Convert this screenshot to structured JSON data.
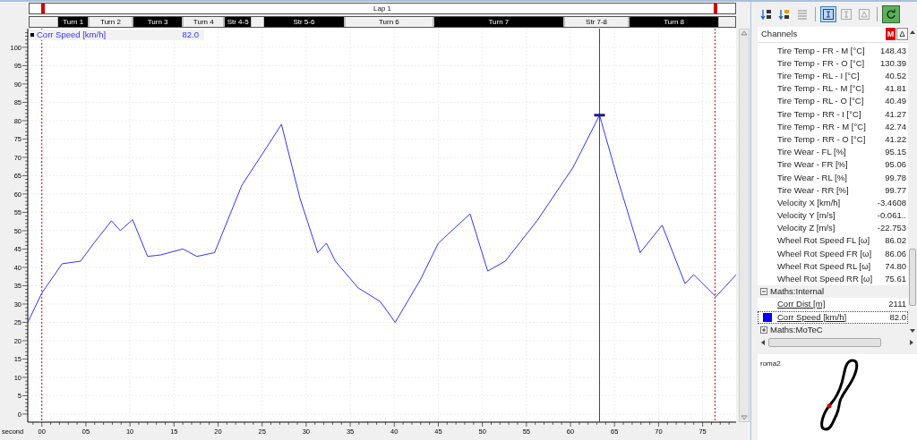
{
  "lap_bar": {
    "label": "Lap 1"
  },
  "sections": [
    {
      "label": "Turn 1",
      "color": "#000000"
    },
    {
      "label": "Turn 2",
      "color": "#f0f0f0"
    },
    {
      "label": "Turn 3",
      "color": "#000000"
    },
    {
      "label": "Turn 4",
      "color": "#f0f0f0"
    },
    {
      "label": "Str 4-5",
      "color": "#000000"
    },
    {
      "label": "Str 5-6",
      "color": "#000000"
    },
    {
      "label": "Turn 6",
      "color": "#f0f0f0"
    },
    {
      "label": "Turn 7",
      "color": "#000000"
    },
    {
      "label": "Str 7-8",
      "color": "#f0f0f0"
    },
    {
      "label": "Turn 8",
      "color": "#000000"
    }
  ],
  "legend": {
    "value": "82.0"
  },
  "chart": {
    "chart_data": {
      "type": "line",
      "xlabel": "second",
      "grid": true,
      "x": [
        -1.6,
        0,
        2.3,
        4.4,
        5.9,
        7.9,
        8.9,
        10.3,
        12,
        13.5,
        16,
        17.6,
        19.6,
        22.7,
        25.7,
        27.2,
        29.3,
        31.3,
        32.3,
        33.3,
        35.9,
        38.4,
        40.1,
        43,
        45,
        48.6,
        50.6,
        52.6,
        56.2,
        60.3,
        63.3,
        65.4,
        67.9,
        70.4,
        73,
        74,
        76.5,
        78.8
      ],
      "series": [
        {
          "name": "Corr Speed [km/h]",
          "color": "#3333ff",
          "values": [
            25,
            33,
            41,
            41.7,
            46.6,
            52.7,
            50,
            53,
            43,
            43.4,
            45,
            43,
            44,
            62.4,
            73.4,
            79,
            58.8,
            44,
            46.6,
            41.7,
            34.4,
            30.7,
            25,
            36.8,
            46.6,
            54.6,
            39,
            41.7,
            52.7,
            67.3,
            81.5,
            63.7,
            44,
            51.5,
            35.6,
            38,
            32,
            38
          ]
        }
      ],
      "xlim": [
        -1.6,
        78.8
      ],
      "ylim": [
        -2.2,
        105.1
      ],
      "xticks": [
        {
          "value": 0,
          "label": "00"
        },
        {
          "value": 5,
          "label": "05"
        },
        {
          "value": 10,
          "label": "10"
        },
        {
          "value": 15,
          "label": "15"
        },
        {
          "value": 20,
          "label": "20"
        },
        {
          "value": 25,
          "label": "25"
        },
        {
          "value": 30,
          "label": "30"
        },
        {
          "value": 35,
          "label": "35"
        },
        {
          "value": 40,
          "label": "40"
        },
        {
          "value": 45,
          "label": "45"
        },
        {
          "value": 50,
          "label": "50"
        },
        {
          "value": 55,
          "label": "55"
        },
        {
          "value": 60,
          "label": "60"
        },
        {
          "value": 65,
          "label": "65"
        },
        {
          "value": 70,
          "label": "70"
        },
        {
          "value": 75,
          "label": "75"
        }
      ],
      "yticks": [
        0,
        5,
        10,
        15,
        20,
        25,
        30,
        35,
        40,
        45,
        50,
        55,
        60,
        65,
        70,
        75,
        80,
        85,
        90,
        95,
        100
      ],
      "ref_lines": [
        {
          "axis": "x",
          "value": 0,
          "color": "#cc0000"
        },
        {
          "axis": "x",
          "value": 76.4,
          "color": "#cc0000"
        },
        {
          "axis": "x",
          "value": 63.3,
          "color": "#3333ff"
        }
      ]
    }
  },
  "toolbar": [
    {
      "kind": "sort-numeric"
    },
    {
      "kind": "sort-alpha"
    },
    {
      "kind": "list"
    },
    {
      "kind": "separator"
    },
    {
      "kind": "cursor",
      "pressed": true
    },
    {
      "kind": "cursor",
      "pressed": false
    },
    {
      "kind": "delta",
      "pressed": false
    },
    {
      "kind": "separator"
    },
    {
      "kind": "refresh"
    }
  ],
  "channels": {
    "header": "Channels",
    "mode_button": "M",
    "delta_button": "Δ",
    "items": [
      {
        "name": "Tire Temp - FR - M [°C]",
        "value": "148.43",
        "selected": false
      },
      {
        "name": "Tire Temp - FR - O [°C]",
        "value": "130.39",
        "selected": false
      },
      {
        "name": "Tire Temp - RL - I [°C]",
        "value": "40.52",
        "selected": false
      },
      {
        "name": "Tire Temp - RL - M [°C]",
        "value": "41.81",
        "selected": false
      },
      {
        "name": "Tire Temp - RL - O [°C]",
        "value": "40.49",
        "selected": false
      },
      {
        "name": "Tire Temp - RR - I [°C]",
        "value": "41.27",
        "selected": false
      },
      {
        "name": "Tire Temp - RR - M [°C]",
        "value": "42.74",
        "selected": false
      },
      {
        "name": "Tire Temp - RR - O [°C]",
        "value": "41.22",
        "selected": false
      },
      {
        "name": "Tire Wear - FL [%]",
        "value": "95.15",
        "selected": false
      },
      {
        "name": "Tire Wear - FR [%]",
        "value": "95.06",
        "selected": false
      },
      {
        "name": "Tire Wear - RL [%]",
        "value": "99.78",
        "selected": false
      },
      {
        "name": "Tire Wear - RR [%]",
        "value": "99.77",
        "selected": false
      },
      {
        "name": "Velocity X [km/h]",
        "value": "-3.4608",
        "selected": false
      },
      {
        "name": "Velocity Y [m/s]",
        "value": "-0.061..",
        "selected": false
      },
      {
        "name": "Velocity Z [m/s]",
        "value": "-22.753",
        "selected": false
      },
      {
        "name": "Wheel Rot Speed FL [ω]",
        "value": "86.02",
        "selected": false
      },
      {
        "name": "Wheel Rot Speed FR [ω]",
        "value": "86.06",
        "selected": false
      },
      {
        "name": "Wheel Rot Speed RL [ω]",
        "value": "74.80",
        "selected": false
      },
      {
        "name": "Wheel Rot Speed RR [ω]",
        "value": "75.61",
        "selected": false
      }
    ],
    "groups": [
      {
        "label": "Maths:Internal",
        "expanded": true,
        "children": [
          {
            "name": "Corr Dist [m]",
            "value": "2111",
            "selected": false
          },
          {
            "name": "Corr Speed [km/h]",
            "value": "82.0",
            "selected": true,
            "color": "#0000ff"
          }
        ]
      },
      {
        "label": "Maths:MoTeC",
        "expanded": false
      }
    ]
  },
  "track_map": {
    "name": "roma2"
  }
}
